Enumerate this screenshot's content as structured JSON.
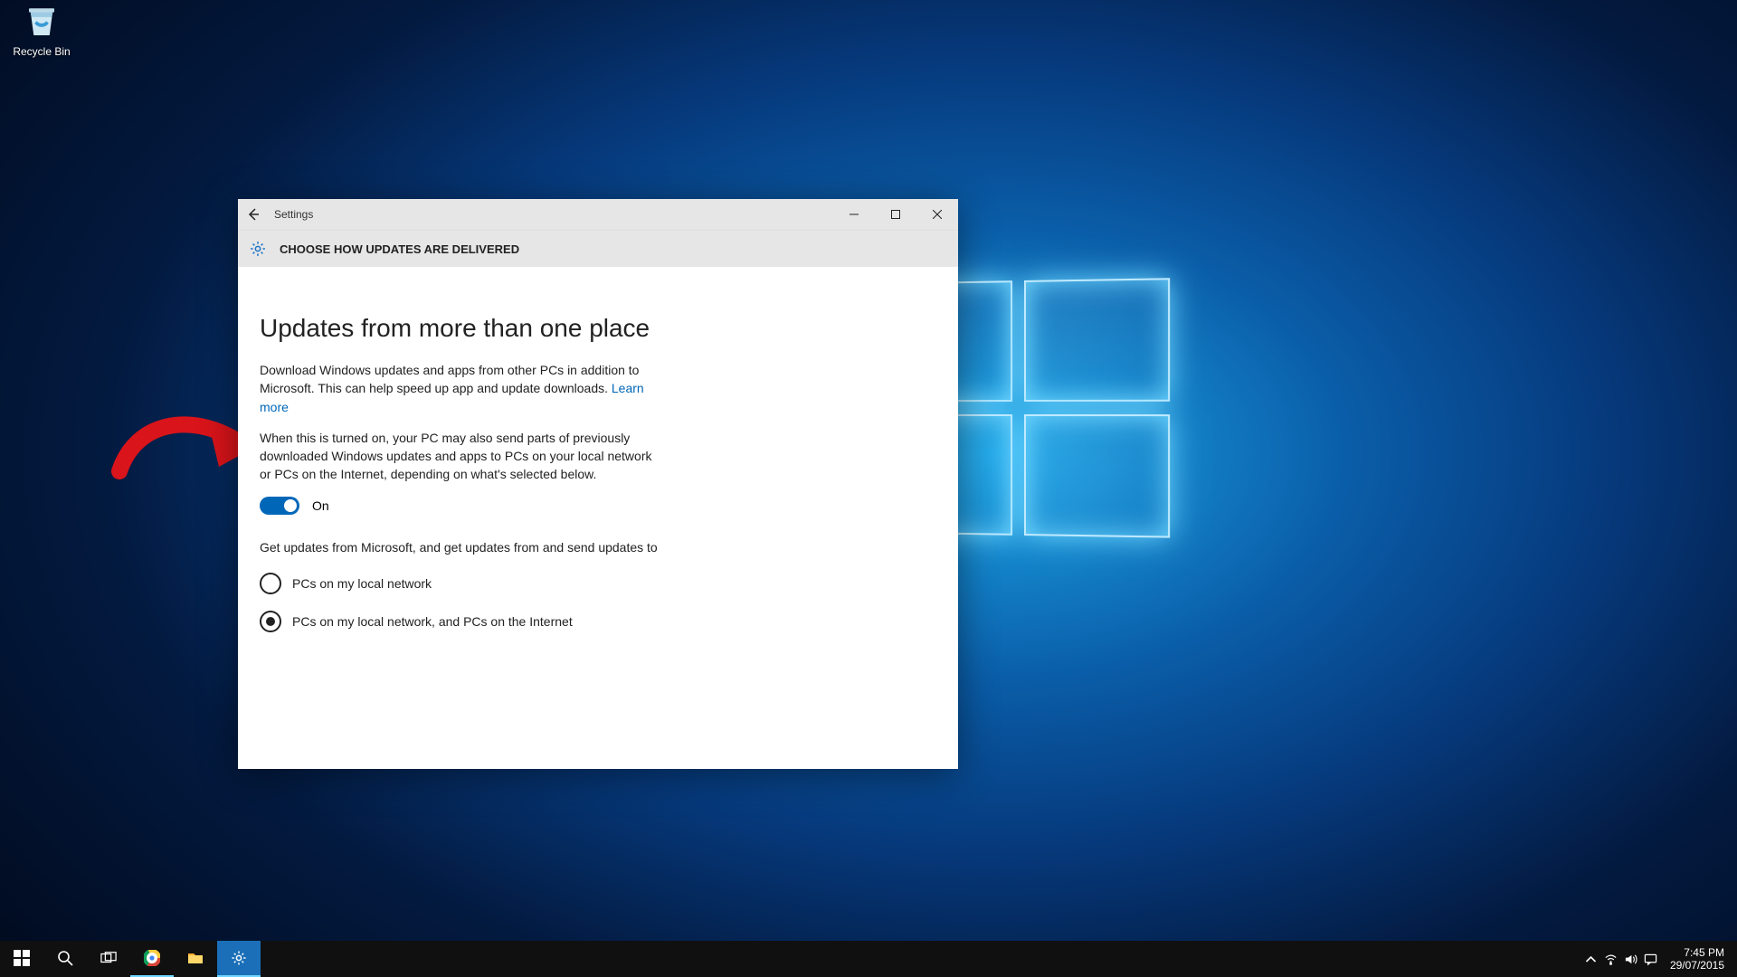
{
  "desktop": {
    "recycle_label": "Recycle Bin"
  },
  "window": {
    "title": "Settings",
    "subheader": "CHOOSE HOW UPDATES ARE DELIVERED",
    "heading": "Updates from more than one place",
    "paragraph1": "Download Windows updates and apps from other PCs in addition to Microsoft. This can help speed up app and update downloads.",
    "learn_more": "Learn more",
    "paragraph2": "When this is turned on, your PC may also send parts of previously downloaded Windows updates and apps to PCs on your local network or PCs on the Internet, depending on what's selected below.",
    "toggle_state": "On",
    "toggle_on": true,
    "paragraph3": "Get updates from Microsoft, and get updates from and send updates to",
    "radio1": "PCs on my local network",
    "radio2": "PCs on my local network, and PCs on the Internet",
    "selected_radio": 2
  },
  "taskbar": {
    "time": "7:45 PM",
    "date": "29/07/2015"
  }
}
